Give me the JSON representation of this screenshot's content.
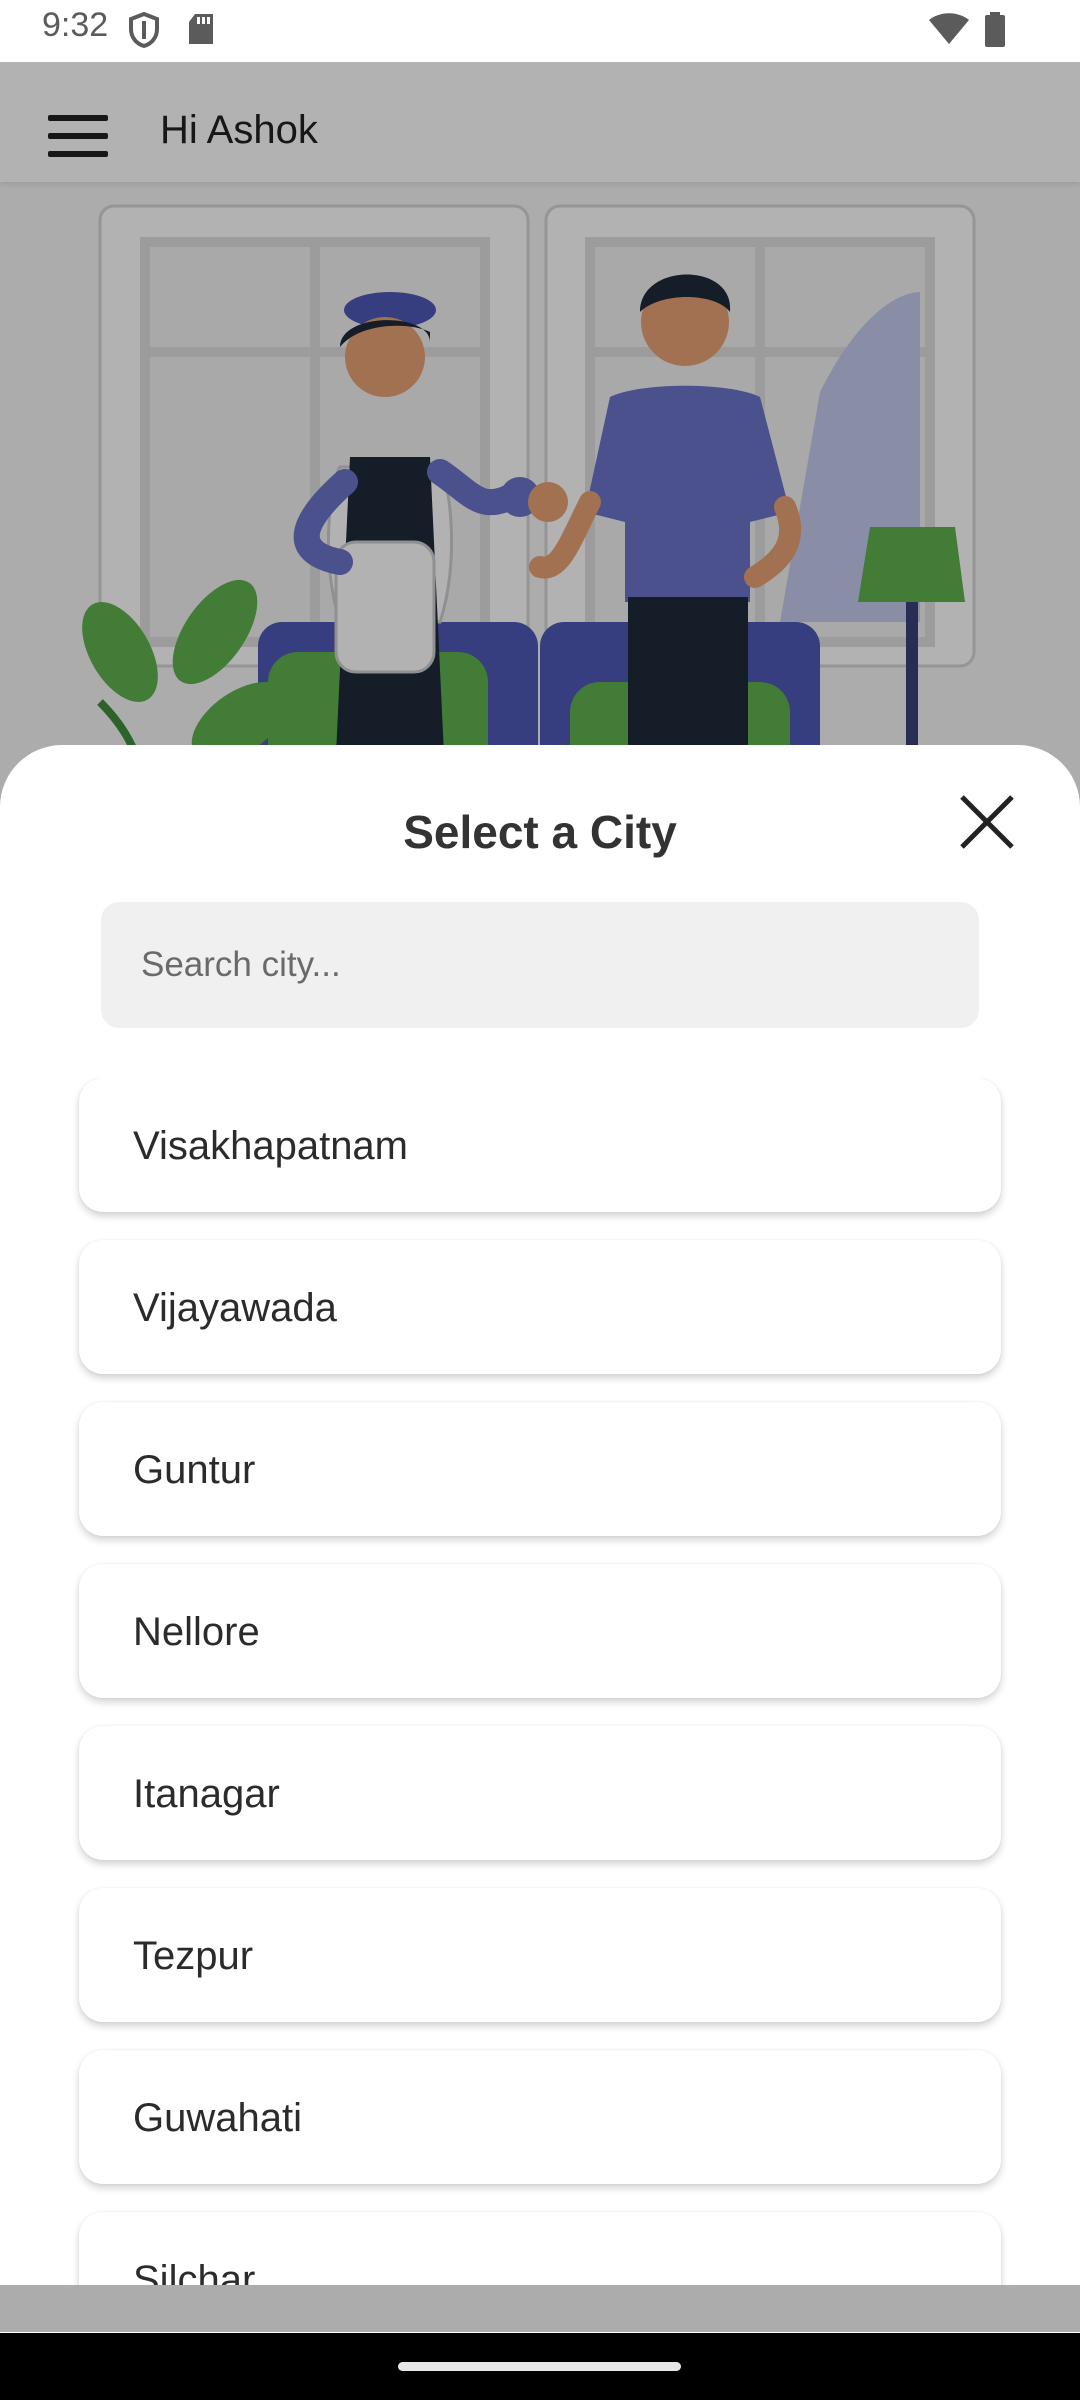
{
  "status_bar": {
    "time": "9:32",
    "icons": [
      "shield-icon",
      "sd-card-icon",
      "wifi-icon",
      "battery-icon"
    ]
  },
  "app_bar": {
    "title": "Hi Ashok",
    "menu_icon": "hamburger-menu-icon"
  },
  "hero": {
    "illustration": "cleaning-staff-and-customer-thumbs-up-illustration"
  },
  "city_sheet": {
    "title": "Select a City",
    "close_icon": "close-icon",
    "search": {
      "placeholder": "Search city...",
      "value": ""
    },
    "cities": [
      "Visakhapatnam",
      "Vijayawada",
      "Guntur",
      "Nellore",
      "Itanagar",
      "Tezpur",
      "Guwahati",
      "Silchar"
    ]
  },
  "colors": {
    "scrim": "#000000",
    "sheet_background": "#ffffff",
    "search_background": "#f0f0f0",
    "illustration_accent": "#6b74c9",
    "illustration_green": "#5fb24f"
  }
}
